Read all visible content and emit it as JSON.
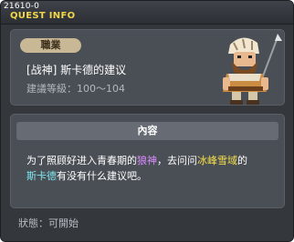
{
  "window": {
    "quest_id": "21610-0",
    "title": "QUEST INFO"
  },
  "quest": {
    "job_badge": "職業",
    "name": "[战神] 斯卡德的建议",
    "level_req": "建議等級：100～104",
    "npc_icon": "npc-warrior-portrait"
  },
  "content": {
    "header": "內容",
    "line1_a": "为了照顾好进入青春期的",
    "line1_hl1": "狼神",
    "line1_b": "，去问问",
    "line1_hl2": "冰峰雪域",
    "line1_c": "的",
    "line2_hl": "斯卡德",
    "line2_a": "有没有什么建议吧。"
  },
  "status": {
    "text": "狀態：可開始"
  },
  "colors": {
    "title": "#f2d64a",
    "badge": "#c9b895",
    "highlight_violet": "#d98cff",
    "highlight_yellow": "#f5e04a",
    "highlight_cyan": "#7fe8f2"
  }
}
